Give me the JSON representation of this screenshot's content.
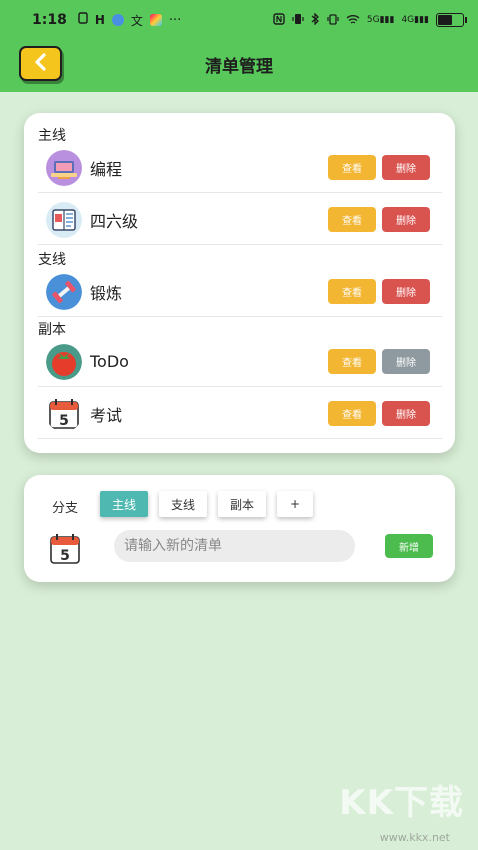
{
  "status_bar": {
    "time": "1:18",
    "left_icons": [
      "sim-icon",
      "h-icon",
      "app-icon",
      "translate-icon",
      "app2-icon",
      "more-icon"
    ],
    "more_text": "···",
    "network": "5G",
    "network2": "4G"
  },
  "header": {
    "title": "清单管理"
  },
  "list_card": {
    "sections": [
      {
        "label": "主线",
        "items": [
          {
            "name": "编程",
            "icon": "laptop-icon",
            "view": "查看",
            "delete": "删除"
          },
          {
            "name": "四六级",
            "icon": "book-icon",
            "view": "查看",
            "delete": "删除"
          }
        ]
      },
      {
        "label": "支线",
        "items": [
          {
            "name": "锻炼",
            "icon": "dumbbell-icon",
            "view": "查看",
            "delete": "删除"
          }
        ]
      },
      {
        "label": "副本",
        "items": [
          {
            "name": "ToDo",
            "icon": "tomato-icon",
            "view": "查看",
            "delete": "删除"
          },
          {
            "name": "考试",
            "icon": "calendar-icon",
            "view": "查看",
            "delete": "删除"
          }
        ]
      }
    ]
  },
  "add_card": {
    "branch_label": "分支",
    "chips": [
      "主线",
      "支线",
      "副本",
      "+"
    ],
    "input_placeholder": "请输入新的清单",
    "new_button": "新增"
  },
  "colors": {
    "header_green": "#58c85a",
    "page_bg": "#d8eed6",
    "view_yellow": "#f2b632",
    "delete_red": "#d9534f",
    "delete_gray": "#8e9aa0",
    "chip_active": "#4fb8b0",
    "new_green": "#4cbc4e"
  },
  "watermark": {
    "text": "KK下载",
    "url": "www.kkx.net"
  }
}
